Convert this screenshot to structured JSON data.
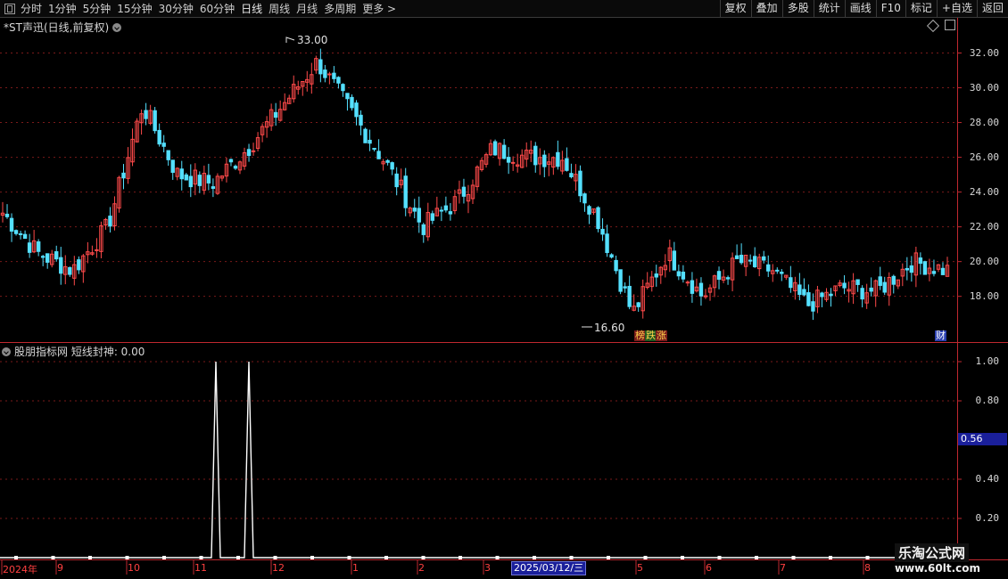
{
  "toolbar": {
    "periods": [
      "分时",
      "1分钟",
      "5分钟",
      "15分钟",
      "30分钟",
      "60分钟",
      "日线",
      "周线",
      "月线",
      "多周期",
      "更多 >"
    ],
    "active_period": "日线",
    "right_buttons": [
      "复权",
      "叠加",
      "多股",
      "统计",
      "画线",
      "F10",
      "标记",
      "+自选",
      "返回"
    ]
  },
  "main_panel": {
    "title": "*ST声迅(日线,前复权)",
    "y_ticks": [
      "32.00",
      "30.00",
      "28.00",
      "26.00",
      "24.00",
      "22.00",
      "20.00",
      "18.00"
    ],
    "high_label": "33.00",
    "low_label": "16.60",
    "badges": [
      {
        "text": "榜",
        "color": "#ffd24a",
        "bg": "#7a1c1c"
      },
      {
        "text": "跌",
        "color": "#ffd24a",
        "bg": "#1f5a1f"
      },
      {
        "text": "涨",
        "color": "#ffd24a",
        "bg": "#7a1c1c"
      },
      {
        "text": "财",
        "color": "#ffffff",
        "bg": "#2a3fb0"
      }
    ]
  },
  "sub_panel": {
    "title": "股朋指标网  短线封神: 0.00",
    "y_ticks": [
      "1.00",
      "0.80",
      "0.40",
      "0.20"
    ],
    "cursor_value": "0.56"
  },
  "x_axis": {
    "labels": [
      "2024年",
      "9",
      "10",
      "11",
      "12",
      "1",
      "2",
      "3",
      "5",
      "6",
      "7",
      "8"
    ],
    "crosshair_date": "2025/03/12/三"
  },
  "watermark": {
    "line1": "乐淘公式网",
    "line2": "www.60lt.com"
  },
  "colors": {
    "up": "#ff4a4a",
    "down": "#54e0ff",
    "grid": "#7a1a1a",
    "signal": "#ffffff"
  },
  "chart_data": [
    {
      "type": "candlestick",
      "title": "*ST声迅(日线,前复权)",
      "ylim": [
        16.6,
        33.0
      ],
      "high": 33.0,
      "low": 16.6,
      "close_path": [
        [
          "2024-08",
          22.8
        ],
        [
          "2024-09",
          20.5
        ],
        [
          "2024-09",
          19.5
        ],
        [
          "2024-10",
          22.0
        ],
        [
          "2024-10",
          29.0
        ],
        [
          "2024-10",
          25.0
        ],
        [
          "2024-11",
          24.5
        ],
        [
          "2024-11",
          26.5
        ],
        [
          "2024-12",
          29.0
        ],
        [
          "2024-12",
          31.5
        ],
        [
          "2024-12",
          28.5
        ],
        [
          "2025-01",
          25.5
        ],
        [
          "2025-01",
          22.0
        ],
        [
          "2025-01",
          23.5
        ],
        [
          "2025-02",
          26.5
        ],
        [
          "2025-02",
          26.0
        ],
        [
          "2025-03",
          26.0
        ],
        [
          "2025-03",
          22.5
        ],
        [
          "2025-04",
          17.0
        ],
        [
          "2025-04",
          20.5
        ],
        [
          "2025-05",
          18.0
        ],
        [
          "2025-05",
          20.0
        ],
        [
          "2025-06",
          19.5
        ],
        [
          "2025-06",
          17.5
        ],
        [
          "2025-07",
          18.5
        ],
        [
          "2025-07",
          18.3
        ],
        [
          "2025-08",
          20.0
        ],
        [
          "2025-08",
          19.5
        ]
      ]
    },
    {
      "type": "line",
      "title": "短线封神",
      "ylim": [
        0,
        1
      ],
      "value": 0.0,
      "signals": [
        {
          "x": "2024-11",
          "y": 1.0
        },
        {
          "x": "2024-11",
          "y": 1.0
        }
      ]
    }
  ]
}
